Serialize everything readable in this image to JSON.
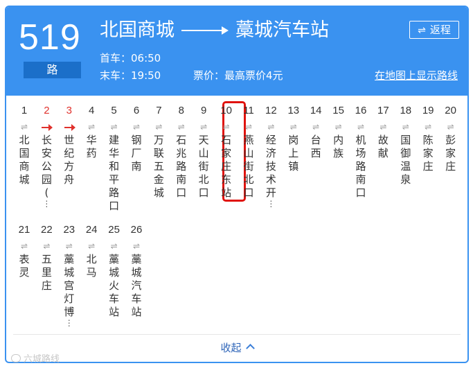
{
  "route": {
    "number": "519",
    "unit": "路",
    "from": "北国商城",
    "to": "藁城汽车站",
    "first_bus": "首车：06:50",
    "last_bus": "末车：19:50",
    "fare": "票价：最高票价4元",
    "return_label": "返程",
    "map_link": "在地图上显示路线"
  },
  "stops": [
    {
      "num": "1",
      "name": "北国商城",
      "more": ""
    },
    {
      "num": "2",
      "name": "长安公园(",
      "more": "⋮"
    },
    {
      "num": "3",
      "name": "世纪方舟",
      "more": ""
    },
    {
      "num": "4",
      "name": "华药",
      "more": ""
    },
    {
      "num": "5",
      "name": "建华和平路口",
      "more": ""
    },
    {
      "num": "6",
      "name": "钢厂南",
      "more": ""
    },
    {
      "num": "7",
      "name": "万联五金城",
      "more": ""
    },
    {
      "num": "8",
      "name": "石兆路南口",
      "more": ""
    },
    {
      "num": "9",
      "name": "天山街北口",
      "more": ""
    },
    {
      "num": "10",
      "name": "石家庄东站",
      "more": ""
    },
    {
      "num": "11",
      "name": "燕山街北口",
      "more": ""
    },
    {
      "num": "12",
      "name": "经济技术开",
      "more": "⋮"
    },
    {
      "num": "13",
      "name": "岗上镇",
      "more": ""
    },
    {
      "num": "14",
      "name": "台西",
      "more": ""
    },
    {
      "num": "15",
      "name": "内族",
      "more": ""
    },
    {
      "num": "16",
      "name": "机场路南口",
      "more": ""
    },
    {
      "num": "17",
      "name": "故献",
      "more": ""
    },
    {
      "num": "18",
      "name": "国御温泉",
      "more": ""
    },
    {
      "num": "19",
      "name": "陈家庄",
      "more": ""
    },
    {
      "num": "20",
      "name": "彭家庄",
      "more": ""
    },
    {
      "num": "21",
      "name": "表灵",
      "more": ""
    },
    {
      "num": "22",
      "name": "五里庄",
      "more": ""
    },
    {
      "num": "23",
      "name": "藁城宫灯博",
      "more": "⋮"
    },
    {
      "num": "24",
      "name": "北马",
      "more": ""
    },
    {
      "num": "25",
      "name": "藁城火车站",
      "more": ""
    },
    {
      "num": "26",
      "name": "藁城汽车站",
      "more": ""
    }
  ],
  "direction_glyph": "⇌",
  "collapse_label": "收起",
  "watermark": "六城路线",
  "colors": {
    "header_bg": "#3a92f0",
    "unit_bg": "#1b6fc9",
    "active_stop": "#e0312c",
    "highlight_border": "#e0120c"
  }
}
